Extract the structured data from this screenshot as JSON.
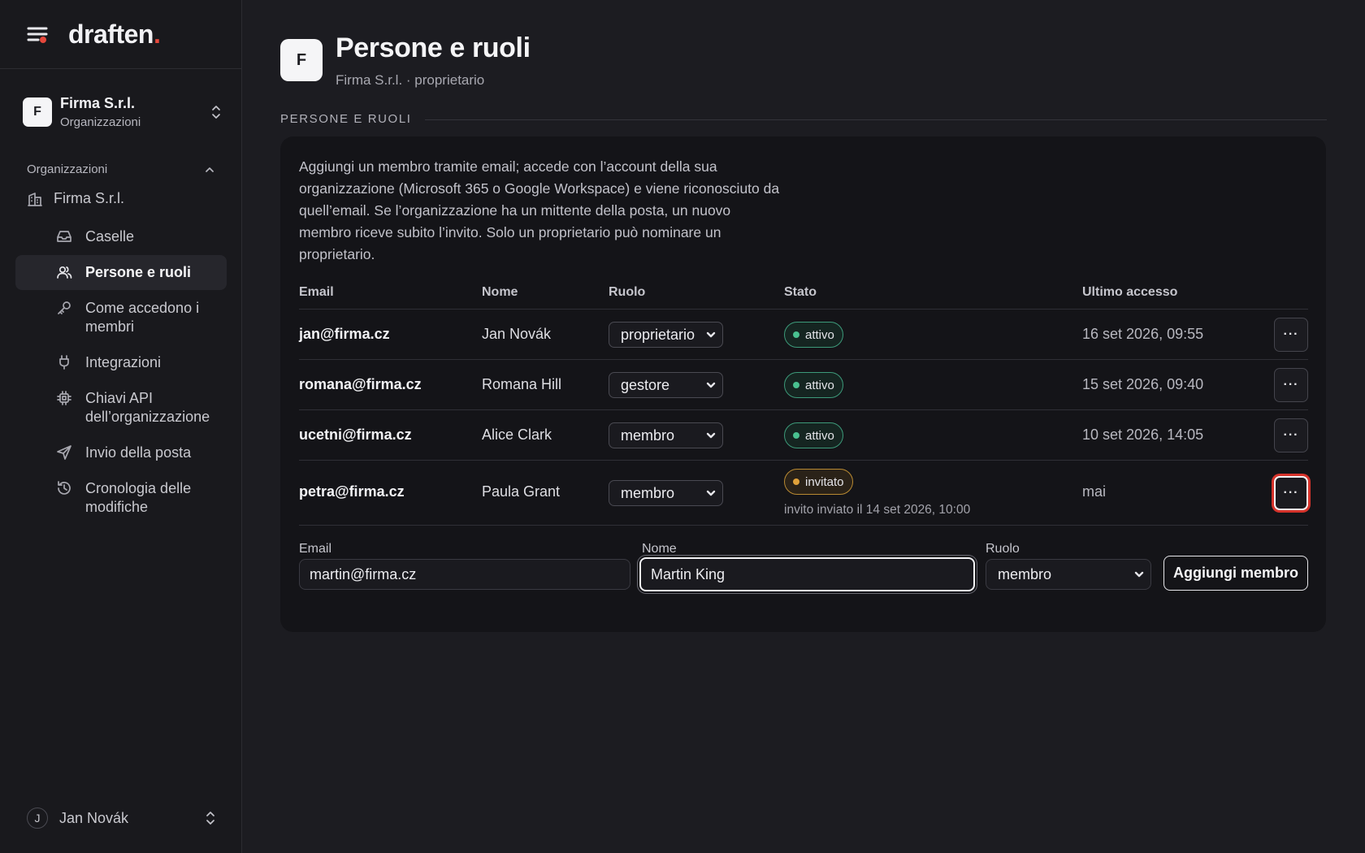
{
  "brand": {
    "name": "draften",
    "dot": ".",
    "accent_color": "#e5483c"
  },
  "org_switcher": {
    "initial": "F",
    "name": "Firma S.r.l.",
    "subtitle": "Organizzazioni"
  },
  "sidebar": {
    "section_label": "Organizzazioni",
    "org_item": "Firma S.r.l.",
    "items": [
      {
        "label": "Caselle",
        "icon": "inbox-icon",
        "active": false
      },
      {
        "label": "Persone e ruoli",
        "icon": "users-icon",
        "active": true
      },
      {
        "label": "Come accedono i membri",
        "icon": "key-icon",
        "active": false
      },
      {
        "label": "Integrazioni",
        "icon": "plug-icon",
        "active": false
      },
      {
        "label": "Chiavi API dell’organizzazione",
        "icon": "chip-icon",
        "active": false
      },
      {
        "label": "Invio della posta",
        "icon": "send-icon",
        "active": false
      },
      {
        "label": "Cronologia delle modifiche",
        "icon": "history-icon",
        "active": false
      }
    ],
    "user": {
      "initial": "J",
      "name": "Jan Novák"
    }
  },
  "page": {
    "initial": "F",
    "title": "Persone e ruoli",
    "subtitle": "Firma S.r.l. · proprietario",
    "section_label": "PERSONE E RUOLI",
    "intro": "Aggiungi un membro tramite email; accede con l’account della sua organizzazione (Microsoft 365 o Google Workspace) e viene riconosciuto da quell’email. Se l’organizzazione ha un mittente della posta, un nuovo membro riceve subito l’invito. Solo un proprietario può nominare un proprietario."
  },
  "table": {
    "headers": {
      "email": "Email",
      "name": "Nome",
      "role": "Ruolo",
      "state": "Stato",
      "last": "Ultimo accesso"
    },
    "rows": [
      {
        "email": "jan@firma.cz",
        "name": "Jan Novák",
        "role": "proprietario",
        "state": "attivo",
        "state_kind": "active",
        "note": "",
        "last": "16 set 2026, 09:55"
      },
      {
        "email": "romana@firma.cz",
        "name": "Romana Hill",
        "role": "gestore",
        "state": "attivo",
        "state_kind": "active",
        "note": "",
        "last": "15 set 2026, 09:40"
      },
      {
        "email": "ucetni@firma.cz",
        "name": "Alice Clark",
        "role": "membro",
        "state": "attivo",
        "state_kind": "active",
        "note": "",
        "last": "10 set 2026, 14:05"
      },
      {
        "email": "petra@firma.cz",
        "name": "Paula Grant",
        "role": "membro",
        "state": "invitato",
        "state_kind": "invited",
        "note": "invito inviato il 14 set 2026, 10:00",
        "last": "mai"
      }
    ],
    "more_label": "···"
  },
  "form": {
    "email_label": "Email",
    "email_value": "martin@firma.cz",
    "name_label": "Nome",
    "name_value": "Martin King",
    "role_label": "Ruolo",
    "role_value": "membro",
    "submit_label": "Aggiungi membro"
  }
}
